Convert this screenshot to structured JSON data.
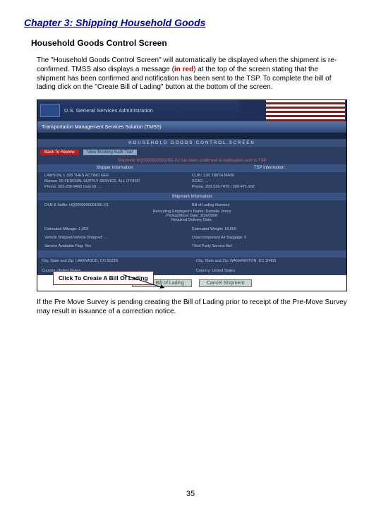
{
  "chapter": "Chapter 3:  Shipping Household Goods",
  "section": "Household Goods Control Screen",
  "para1_a": "The \"Household Goods Control Screen\" will automatically be displayed when the shipment is re-confirmed.  TMSS also displays a message (",
  "para1_red": "in red",
  "para1_b": ") at the top of the screen stating that the shipment has been confirmed and notification has been sent to the TSP.  To complete the bill of lading click on the \"Create Bill of Lading\" button at the bottom of the screen.",
  "para2": "If the Pre Move Survey is pending creating the Bill of Lading prior to receipt of the Pre-Move Survey may result in issuance of a correction notice.",
  "page_number": "35",
  "screenshot": {
    "agency": "U.S. General Services Administration",
    "system": "Transportation Management Services Solution (TMSS)",
    "screen_label": "HOUSEHOLD  GOODS  CONTROL  SCREEN",
    "back_btn": "Back To Review",
    "audit_btn": "View Booking Audit Trail",
    "confirm_msg": "Shipment HQ0000000001051-01 has been confirmed & notification sent to TSP",
    "hdr_shipper": "Shipper Information",
    "hdr_tsp": "TSP Information",
    "shipper_line1": "LAWSON, L        326 THES ACTINO GEE",
    "shipper_line2": "Bureau: 05   FEDERAL SUPPLY SERVICE, ALL OTHER",
    "shipper_line3": "Phone: 303-236-9462   User ID: …",
    "tsp_line1": "CLIN: 1.00      180TH MAIN",
    "tsp_line2": "SCAC: …",
    "tsp_line3": "Phone: 203-239-7470 / 206-471-202",
    "hdr_shipment": "Shipment Information",
    "dsn": "DSN & Suffix: HQ0000000001051-01",
    "bol_label": "Bill of Lading Number:",
    "reloc_name": "Relocating Employee's Name: Danielle Jones",
    "pickup": "Pickup/Move Date: 3/26/2008",
    "reqdel": "Required Delivery Date:",
    "est_mileage": "Estimated Mileage: 1,653",
    "est_weight": "Estimated Weight: 18,000",
    "vehicles": "Vehicle Shipped/Vehicle Dropped: …",
    "unaccomp": "Unaccompanied Air Baggage: 0",
    "srv_flag": "Service Available Flag: Yes",
    "thirdparty": "Third Party Service Bid:",
    "loc_left1": "City, State and Zip: LAKEWOOD, CO 80228",
    "loc_left2": "Country: United States",
    "loc_right1": "City, State and Zip: WASHINGTON, DC 20405",
    "loc_right2": "Country: United States",
    "btn_create": "Create Bill of Lading",
    "btn_cancel": "Cancel Shipment",
    "callout": "Click To Create A Bill Of Lading"
  }
}
